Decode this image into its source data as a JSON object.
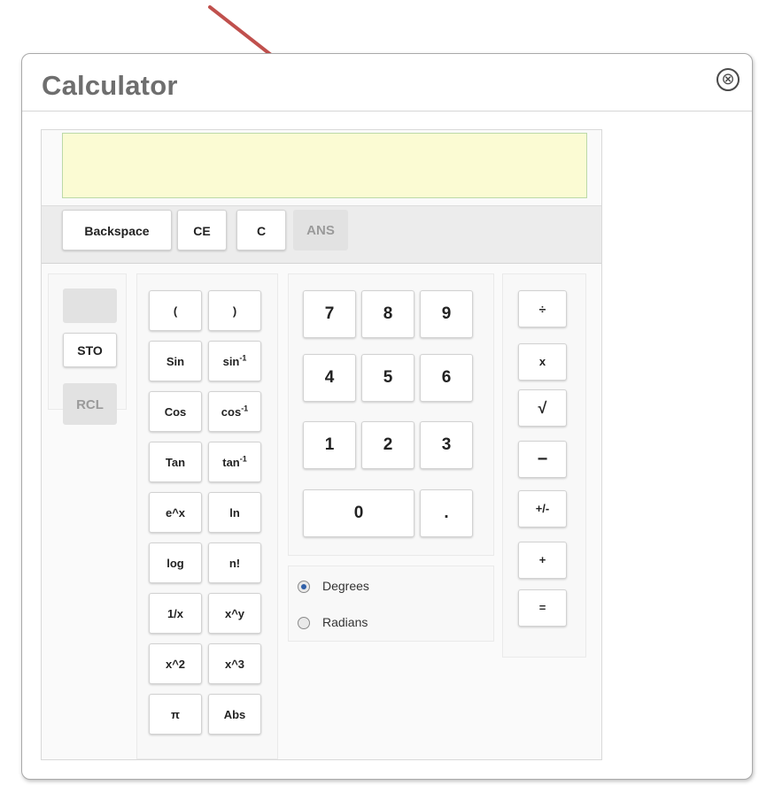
{
  "dialog": {
    "title": "Calculator",
    "close_icon": "close-circle-icon",
    "close_glyph": "⊗"
  },
  "display": {
    "value": ""
  },
  "controls": {
    "backspace": "Backspace",
    "ce": "CE",
    "c": "C",
    "ans": "ANS"
  },
  "memory": {
    "indicator": "",
    "sto": "STO",
    "rcl": "RCL"
  },
  "functions": {
    "open_paren": "(",
    "close_paren": ")",
    "sin": "Sin",
    "asin_base": "sin",
    "cos": "Cos",
    "acos_base": "cos",
    "tan": "Tan",
    "atan_base": "tan",
    "inv_exp": "-1",
    "exp": "e^x",
    "ln": "ln",
    "log": "log",
    "factorial": "n!",
    "reciprocal": "1/x",
    "power": "x^y",
    "square": "x^2",
    "cube": "x^3",
    "pi": "π",
    "abs": "Abs"
  },
  "digits": {
    "d7": "7",
    "d8": "8",
    "d9": "9",
    "d4": "4",
    "d5": "5",
    "d6": "6",
    "d1": "1",
    "d2": "2",
    "d3": "3",
    "d0": "0",
    "dot": "."
  },
  "angle_mode": {
    "degrees": "Degrees",
    "radians": "Radians",
    "selected": "Degrees"
  },
  "operators": {
    "divide": "÷",
    "multiply": "x",
    "sqrt": "√",
    "minus": "−",
    "negate": "+/-",
    "plus": "+",
    "equals": "="
  },
  "colors": {
    "arrow": "#c0504d",
    "display_bg": "#fbfbd3",
    "title": "#6e6e6e"
  }
}
